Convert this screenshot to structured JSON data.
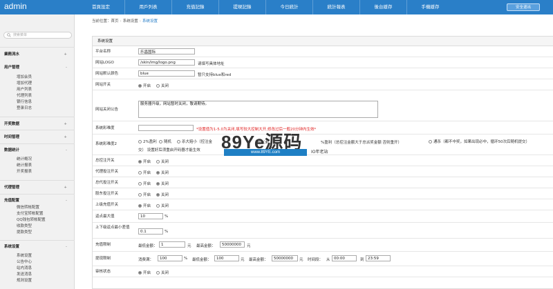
{
  "header": {
    "logo": "admin",
    "nav": [
      "首頁設定",
      "用戶列表",
      "充值記錄",
      "提現記錄",
      "今日統計",
      "統計報表",
      "後台緩存",
      "手機緩存"
    ],
    "logout_label": "安全退出"
  },
  "sidebar": {
    "search_placeholder": "搜索菜单",
    "groups": [
      {
        "label": "業務流水",
        "toggle": "+"
      },
      {
        "label": "用户管理",
        "toggle": "-",
        "items": [
          "增加会员",
          "增加代理",
          "用户列表",
          "代理列表",
          "银行信息",
          "登录日志"
        ]
      },
      {
        "label": "开奖数据",
        "toggle": "+"
      },
      {
        "label": "时间管理",
        "toggle": "+"
      },
      {
        "label": "数据统计",
        "toggle": "-",
        "items": [
          "统计概况",
          "统计报表",
          "开奖报表"
        ]
      },
      {
        "label": "代理管理",
        "toggle": "+"
      },
      {
        "label": "充值配置",
        "toggle": "-",
        "items": [
          "微信转帐配置",
          "支付宝转帐配置",
          "QQ钱包转帐配置",
          "收款类型",
          "提款类型"
        ]
      },
      {
        "label": "系统设置",
        "toggle": "-",
        "items": [
          "系统设置",
          "公告中心",
          "站内消息",
          "发送消息",
          "规则设置"
        ]
      }
    ]
  },
  "breadcrumb": {
    "prefix": "当前位置：首页",
    "middle": "系统设置",
    "current": "系统设置"
  },
  "panel": {
    "title": "系统设置",
    "platform_name": {
      "label": "平台名称",
      "value": "乐昌国际"
    },
    "logo": {
      "label": "网站LOGO",
      "value": "/skin/img/logo.png",
      "hint": "请填写具体地址"
    },
    "color": {
      "label": "网站默认颜色",
      "value": "blue",
      "hint": "暂只支持blue和red"
    },
    "site_switch": {
      "label": "网站开关",
      "on": "开启",
      "off": "关闭"
    },
    "closed_notice": {
      "label": "网站关闭公告",
      "value": "服务器升级，网站暂时关闭，敬请期待。"
    },
    "difficulty": {
      "label": "系统彩难度",
      "hint": "*设置值为1-5.0为关闭,填写较大控制大开,修改过后一般20分钟内生效*"
    },
    "difficulty2": {
      "label": "系统彩难度2",
      "opt1": "2%盈利",
      "opt2": "随机",
      "opt3": "杀大赔小（控注金",
      "opt4": "知（未",
      "opt5": "%盈利（总控注金额大于总派奖金额 否则重开）",
      "opt6": "通杀（都不中奖，如果出现必中，循环50次后随机提交）",
      "line2": "交）    设置好后须重启开码器才能生效"
    },
    "total_bet": {
      "label": "总控注开关",
      "on": "开启",
      "off": "关闭"
    },
    "agent_bet": {
      "label": "代理投注开关",
      "on": "开启",
      "off": "关闭"
    },
    "master_bet": {
      "label": "总代投注开关",
      "on": "开启",
      "off": "关闭"
    },
    "shareholder_bet": {
      "label": "股东投注开关",
      "on": "开启",
      "off": "关闭"
    },
    "rebate_switch": {
      "label": "上级充值开关",
      "on": "开启",
      "off": "关闭"
    },
    "rebate_max": {
      "label": "返点最大值",
      "value": "10",
      "unit": "%"
    },
    "rebate_min": {
      "label": "上下级返点最小差值",
      "value": "0.1",
      "unit": "%"
    },
    "recharge_limit": {
      "label": "充值限制",
      "min_label": "最低金额：",
      "min_value": "1",
      "min_unit": "元",
      "max_label": "最高金额：",
      "max_value": "50000000",
      "max_unit": "元"
    },
    "withdraw_limit": {
      "label": "提现限制",
      "ratio_label": "消费满：",
      "ratio_value": "100",
      "ratio_unit": "%",
      "min_label": "最低金额：",
      "min_value": "100",
      "min_unit": "元",
      "max_label": "最高金额：",
      "max_value": "50000000",
      "max_unit": "元",
      "time_label": "时间段：",
      "time_from_prefix": "从",
      "time_from": "00:00",
      "time_to_prefix": "到",
      "time_to": "23:59"
    },
    "review_status": {
      "label": "审核状态",
      "on": "开启",
      "off": "关闭"
    }
  },
  "watermark": {
    "brand": "89Ye源码",
    "site": "www.89YE.com",
    "tag": "IO年老站"
  },
  "colors": {
    "header": "#2a7fc8",
    "warning": "#e02020"
  }
}
